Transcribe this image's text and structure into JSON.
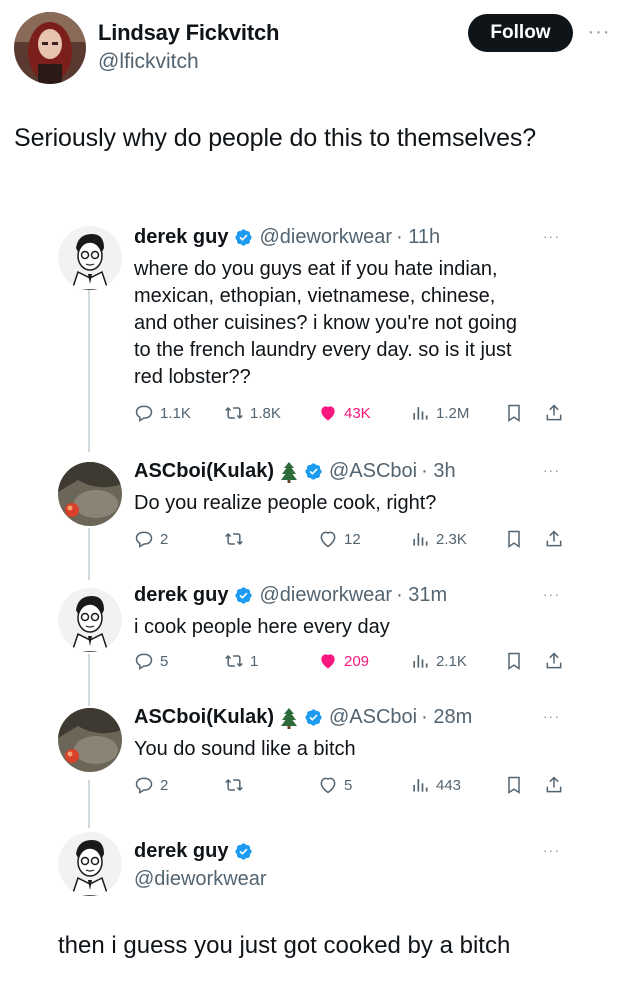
{
  "header": {
    "name": "Lindsay Fickvitch",
    "handle": "@lfickvitch",
    "follow_label": "Follow",
    "more_icon": "more-icon"
  },
  "post_text": "Seriously why do people do this to themselves?",
  "colors": {
    "verified": "#1d9bf0",
    "like": "#f91880",
    "muted": "#536471",
    "line": "#cfd9de"
  },
  "thread": [
    {
      "name": "derek guy",
      "handle": "@dieworkwear",
      "time": "· 11h",
      "verified": true,
      "body_lines": [
        "where do you guys eat if you hate indian,",
        "mexican, ethopian, vietnamese, chinese,",
        "and other cuisines? i know you're not going",
        "to the french laundry every day. so is it just",
        "red lobster??"
      ],
      "replies": "1.1K",
      "reposts": "1.8K",
      "likes": "43K",
      "liked": true,
      "views": "1.2M"
    },
    {
      "name": "ASCboi(Kulak)",
      "handle": "@ASCboi",
      "time": "· 3h",
      "verified": true,
      "body_lines": [
        "Do you realize people cook, right?"
      ],
      "replies": "2",
      "reposts": "",
      "likes": "12",
      "liked": false,
      "views": "2.3K"
    },
    {
      "name": "derek guy",
      "handle": "@dieworkwear",
      "time": "· 31m",
      "verified": true,
      "body_lines": [
        "i cook people here every day"
      ],
      "replies": "5",
      "reposts": "1",
      "likes": "209",
      "liked": true,
      "views": "2.1K"
    },
    {
      "name": "ASCboi(Kulak)",
      "handle": "@ASCboi",
      "time": "· 28m",
      "verified": true,
      "body_lines": [
        "You do sound like a bitch"
      ],
      "replies": "2",
      "reposts": "",
      "likes": "5",
      "liked": false,
      "views": "443"
    }
  ],
  "final": {
    "name": "derek guy",
    "handle": "@dieworkwear",
    "text": "then i guess you just got cooked by a bitch"
  }
}
